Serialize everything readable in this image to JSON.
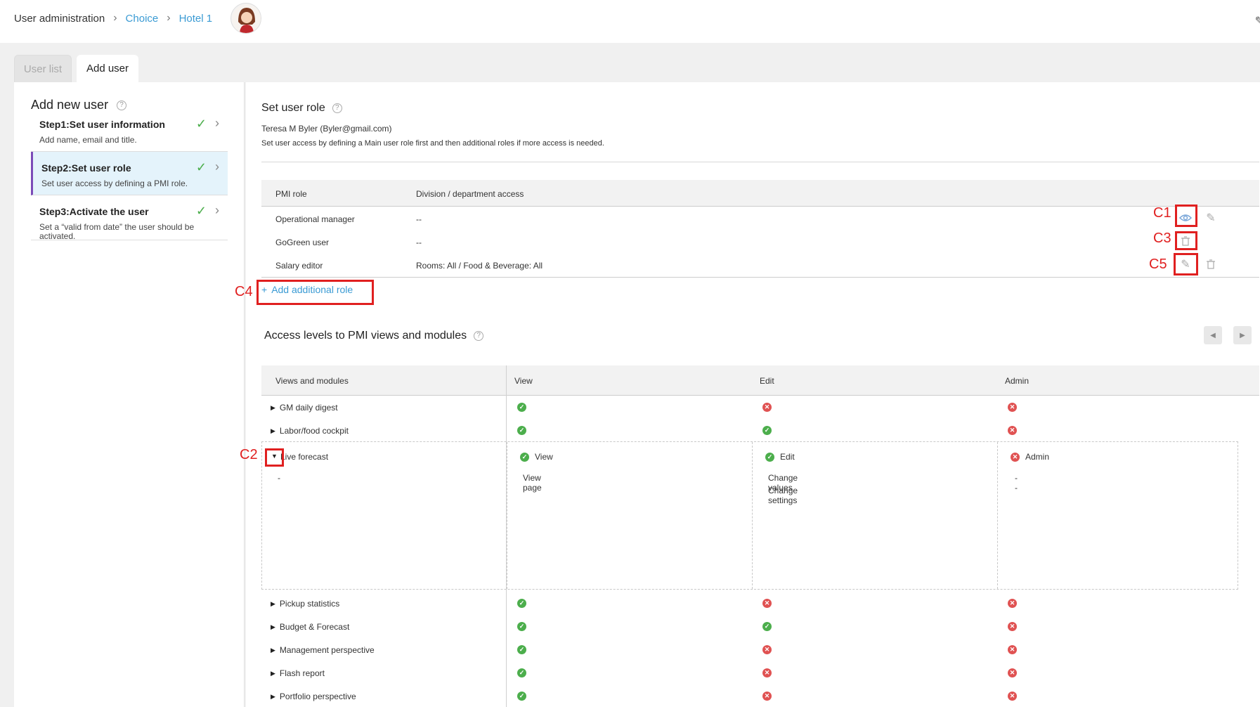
{
  "breadcrumb": {
    "root": "User administration",
    "items": [
      "Choice",
      "Hotel 1"
    ]
  },
  "tabs": {
    "user_list": "User list",
    "add_user": "Add user"
  },
  "left": {
    "title": "Add new user",
    "steps": [
      {
        "title": "Step1:Set user information",
        "desc": "Add name, email and title."
      },
      {
        "title": "Step2:Set user role",
        "desc": "Set user access by defining a PMI role."
      },
      {
        "title": "Step3:Activate the user",
        "desc": "Set a “valid from date” the user should be activated."
      }
    ]
  },
  "main": {
    "title": "Set user role",
    "user_line": "Teresa M Byler (Byler@gmail.com)",
    "hint": "Set user access by defining a Main user role first and then additional roles if more access is needed.",
    "role_headers": {
      "role": "PMI role",
      "division": "Division / department access"
    },
    "roles": [
      {
        "name": "Operational manager",
        "access": "--"
      },
      {
        "name": "GoGreen user",
        "access": "--"
      },
      {
        "name": "Salary editor",
        "access": "Rooms: All / Food & Beverage: All"
      }
    ],
    "add_role": "Add additional role",
    "access_title": "Access levels to PMI views and modules",
    "module_headers": {
      "views": "Views and modules",
      "view": "View",
      "edit": "Edit",
      "admin": "Admin"
    },
    "modules_top": [
      {
        "name": "GM daily digest",
        "view": true,
        "edit": false,
        "admin": false
      },
      {
        "name": "Labor/food cockpit",
        "view": true,
        "edit": true,
        "admin": false
      }
    ],
    "expanded": {
      "name": "Live forecast",
      "sub": "-",
      "view_label": "View",
      "view_items": [
        "View page"
      ],
      "edit_label": "Edit",
      "edit_items": [
        "Change values",
        "Change settings"
      ],
      "admin_label": "Admin",
      "admin_items": [
        "--"
      ]
    },
    "modules_bottom": [
      {
        "name": "Pickup statistics",
        "view": true,
        "edit": false,
        "admin": false
      },
      {
        "name": "Budget & Forecast",
        "view": true,
        "edit": true,
        "admin": false
      },
      {
        "name": "Management perspective",
        "view": true,
        "edit": false,
        "admin": false
      },
      {
        "name": "Flash report",
        "view": true,
        "edit": false,
        "admin": false
      },
      {
        "name": "Portfolio perspective",
        "view": true,
        "edit": false,
        "admin": false
      }
    ]
  },
  "annotations": {
    "c1": "C1",
    "c2": "C2",
    "c3": "C3",
    "c4": "C4",
    "c5": "C5"
  },
  "colors": {
    "accent": "#3b9bd4",
    "active_step": "#e4f3fb",
    "ok": "#4cae4c",
    "no": "#e05252",
    "annotation": "#e02020"
  }
}
